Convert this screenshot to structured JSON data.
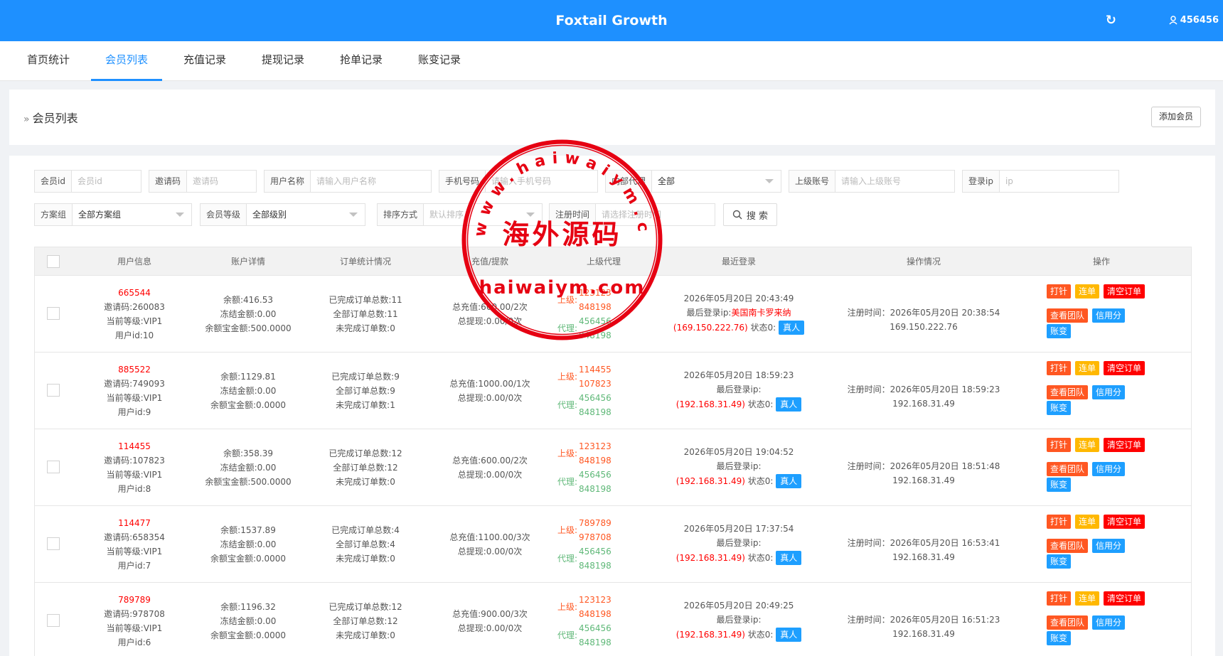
{
  "app": {
    "title": "Foxtail Growth",
    "user": "456456"
  },
  "tabs": [
    "首页统计",
    "会员列表",
    "充值记录",
    "提现记录",
    "抢单记录",
    "账变记录"
  ],
  "active_tab": 1,
  "page": {
    "title": "会员列表",
    "add_button": "添加会员"
  },
  "filters": {
    "member_id": {
      "label": "会员id",
      "placeholder": "会员id"
    },
    "invite_code": {
      "label": "邀请码",
      "placeholder": "邀请码"
    },
    "username": {
      "label": "用户名称",
      "placeholder": "请输入用户名称"
    },
    "phone": {
      "label": "手机号码",
      "placeholder": "请输入手机号码"
    },
    "internal_agent": {
      "label": "内部代理",
      "value": "全部"
    },
    "parent_account": {
      "label": "上级账号",
      "placeholder": "请输入上级账号"
    },
    "login_ip": {
      "label": "登录ip",
      "placeholder": "ip"
    },
    "plan_group": {
      "label": "方案组",
      "value": "全部方案组"
    },
    "member_level": {
      "label": "会员等级",
      "value": "全部级别"
    },
    "sort": {
      "label": "排序方式",
      "value": "默认排序"
    },
    "register_time": {
      "label": "注册时间",
      "placeholder": "请选择注册时间"
    },
    "search_button": "搜 索"
  },
  "table": {
    "headers": [
      "用户信息",
      "账户详情",
      "订单统计情况",
      "充值/提款",
      "上级代理",
      "最近登录",
      "操作情况",
      "操作"
    ],
    "labels": {
      "parent": "上级:",
      "agent": "代理:",
      "status_real": "真人"
    },
    "action_labels": [
      "打针",
      "连单",
      "清空订单",
      "查看团队",
      "信用分",
      "账变"
    ],
    "rows": [
      {
        "account": "665544",
        "invite": "邀请码:260083",
        "level": "当前等级:VIP1",
        "uid": "用户id:10",
        "balance": "余额:416.53",
        "frozen": "冻结金额:0.00",
        "yuebao": "余额宝金额:500.0000",
        "done": "已完成订单总数:11",
        "all": "全部订单总数:11",
        "undone": "未完成订单数:0",
        "recharge": "总充值:600.00/2次",
        "withdraw": "总提现:0.00/0次",
        "parents": [
          "123123",
          "848198"
        ],
        "agents": [
          "456456",
          "848198"
        ],
        "last_login_time": "2026年05月20日 20:43:49",
        "last_login_ip_label": "最后登录ip:",
        "last_login_loc": "美国南卡罗来纳",
        "last_login_ip": "(169.150.222.76)",
        "status_label": "状态0:",
        "reg_time": "注册时间：2026年05月20日 20:38:54",
        "reg_ip": "169.150.222.76"
      },
      {
        "account": "885522",
        "invite": "邀请码:749093",
        "level": "当前等级:VIP1",
        "uid": "用户id:9",
        "balance": "余额:1129.81",
        "frozen": "冻结金额:0.00",
        "yuebao": "余额宝金额:0.0000",
        "done": "已完成订单总数:9",
        "all": "全部订单总数:9",
        "undone": "未完成订单数:1",
        "recharge": "总充值:1000.00/1次",
        "withdraw": "总提现:0.00/0次",
        "parents": [
          "114455",
          "107823"
        ],
        "agents": [
          "456456",
          "848198"
        ],
        "last_login_time": "2026年05月20日 18:59:23",
        "last_login_ip_label": "最后登录ip:",
        "last_login_loc": "",
        "last_login_ip": "(192.168.31.49)",
        "status_label": "状态0:",
        "reg_time": "注册时间：2026年05月20日 18:59:23",
        "reg_ip": "192.168.31.49"
      },
      {
        "account": "114455",
        "invite": "邀请码:107823",
        "level": "当前等级:VIP1",
        "uid": "用户id:8",
        "balance": "余额:358.39",
        "frozen": "冻结金额:0.00",
        "yuebao": "余额宝金额:500.0000",
        "done": "已完成订单总数:12",
        "all": "全部订单总数:12",
        "undone": "未完成订单数:0",
        "recharge": "总充值:600.00/2次",
        "withdraw": "总提现:0.00/0次",
        "parents": [
          "123123",
          "848198"
        ],
        "agents": [
          "456456",
          "848198"
        ],
        "last_login_time": "2026年05月20日 19:04:52",
        "last_login_ip_label": "最后登录ip:",
        "last_login_loc": "",
        "last_login_ip": "(192.168.31.49)",
        "status_label": "状态0:",
        "reg_time": "注册时间：2026年05月20日 18:51:48",
        "reg_ip": "192.168.31.49"
      },
      {
        "account": "114477",
        "invite": "邀请码:658354",
        "level": "当前等级:VIP1",
        "uid": "用户id:7",
        "balance": "余额:1537.89",
        "frozen": "冻结金额:0.00",
        "yuebao": "余额宝金额:0.0000",
        "done": "已完成订单总数:4",
        "all": "全部订单总数:4",
        "undone": "未完成订单数:0",
        "recharge": "总充值:1100.00/3次",
        "withdraw": "总提现:0.00/0次",
        "parents": [
          "789789",
          "978708"
        ],
        "agents": [
          "456456",
          "848198"
        ],
        "last_login_time": "2026年05月20日 17:37:54",
        "last_login_ip_label": "最后登录ip:",
        "last_login_loc": "",
        "last_login_ip": "(192.168.31.49)",
        "status_label": "状态0:",
        "reg_time": "注册时间：2026年05月20日 16:53:41",
        "reg_ip": "192.168.31.49"
      },
      {
        "account": "789789",
        "invite": "邀请码:978708",
        "level": "当前等级:VIP1",
        "uid": "用户id:6",
        "balance": "余额:1196.32",
        "frozen": "冻结金额:0.00",
        "yuebao": "余额宝金额:0.0000",
        "done": "已完成订单总数:12",
        "all": "全部订单总数:12",
        "undone": "未完成订单数:0",
        "recharge": "总充值:900.00/3次",
        "withdraw": "总提现:0.00/0次",
        "parents": [
          "123123",
          "848198"
        ],
        "agents": [
          "456456",
          "848198"
        ],
        "last_login_time": "2026年05月20日 20:49:25",
        "last_login_ip_label": "最后登录ip:",
        "last_login_loc": "",
        "last_login_ip": "(192.168.31.49)",
        "status_label": "状态0:",
        "reg_time": "注册时间：2026年05月20日 16:51:23",
        "reg_ip": "192.168.31.49"
      }
    ]
  },
  "watermark": {
    "text_top": "www.haiwaiym.com",
    "text_center": "海外源码",
    "text_bottom": "haiwaiym.com",
    "color": "#e60012"
  }
}
